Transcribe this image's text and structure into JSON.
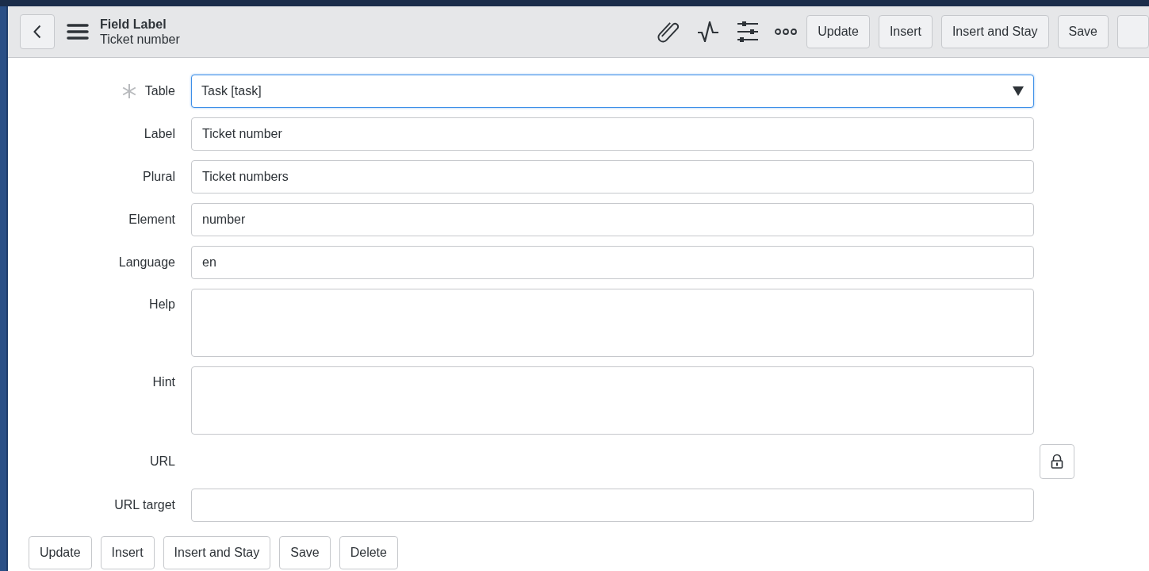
{
  "header": {
    "title": "Field Label",
    "subtitle": "Ticket number",
    "buttons": [
      "Update",
      "Insert",
      "Insert and Stay",
      "Save"
    ]
  },
  "fields": [
    {
      "label": "Table",
      "kind": "select",
      "value": "Task [task]",
      "required": true
    },
    {
      "label": "Label",
      "kind": "text",
      "value": "Ticket number",
      "required": false
    },
    {
      "label": "Plural",
      "kind": "text",
      "value": "Ticket numbers",
      "required": false
    },
    {
      "label": "Element",
      "kind": "text",
      "value": "number",
      "required": false
    },
    {
      "label": "Language",
      "kind": "text",
      "value": "en",
      "required": false
    },
    {
      "label": "Help",
      "kind": "textarea",
      "required": false
    },
    {
      "label": "Hint",
      "kind": "textarea",
      "required": false
    },
    {
      "label": "URL",
      "kind": "locked",
      "required": false
    },
    {
      "label": "URL target",
      "kind": "text",
      "required": false
    }
  ],
  "footer_buttons": [
    "Update",
    "Insert",
    "Insert and Stay",
    "Save",
    "Delete"
  ]
}
